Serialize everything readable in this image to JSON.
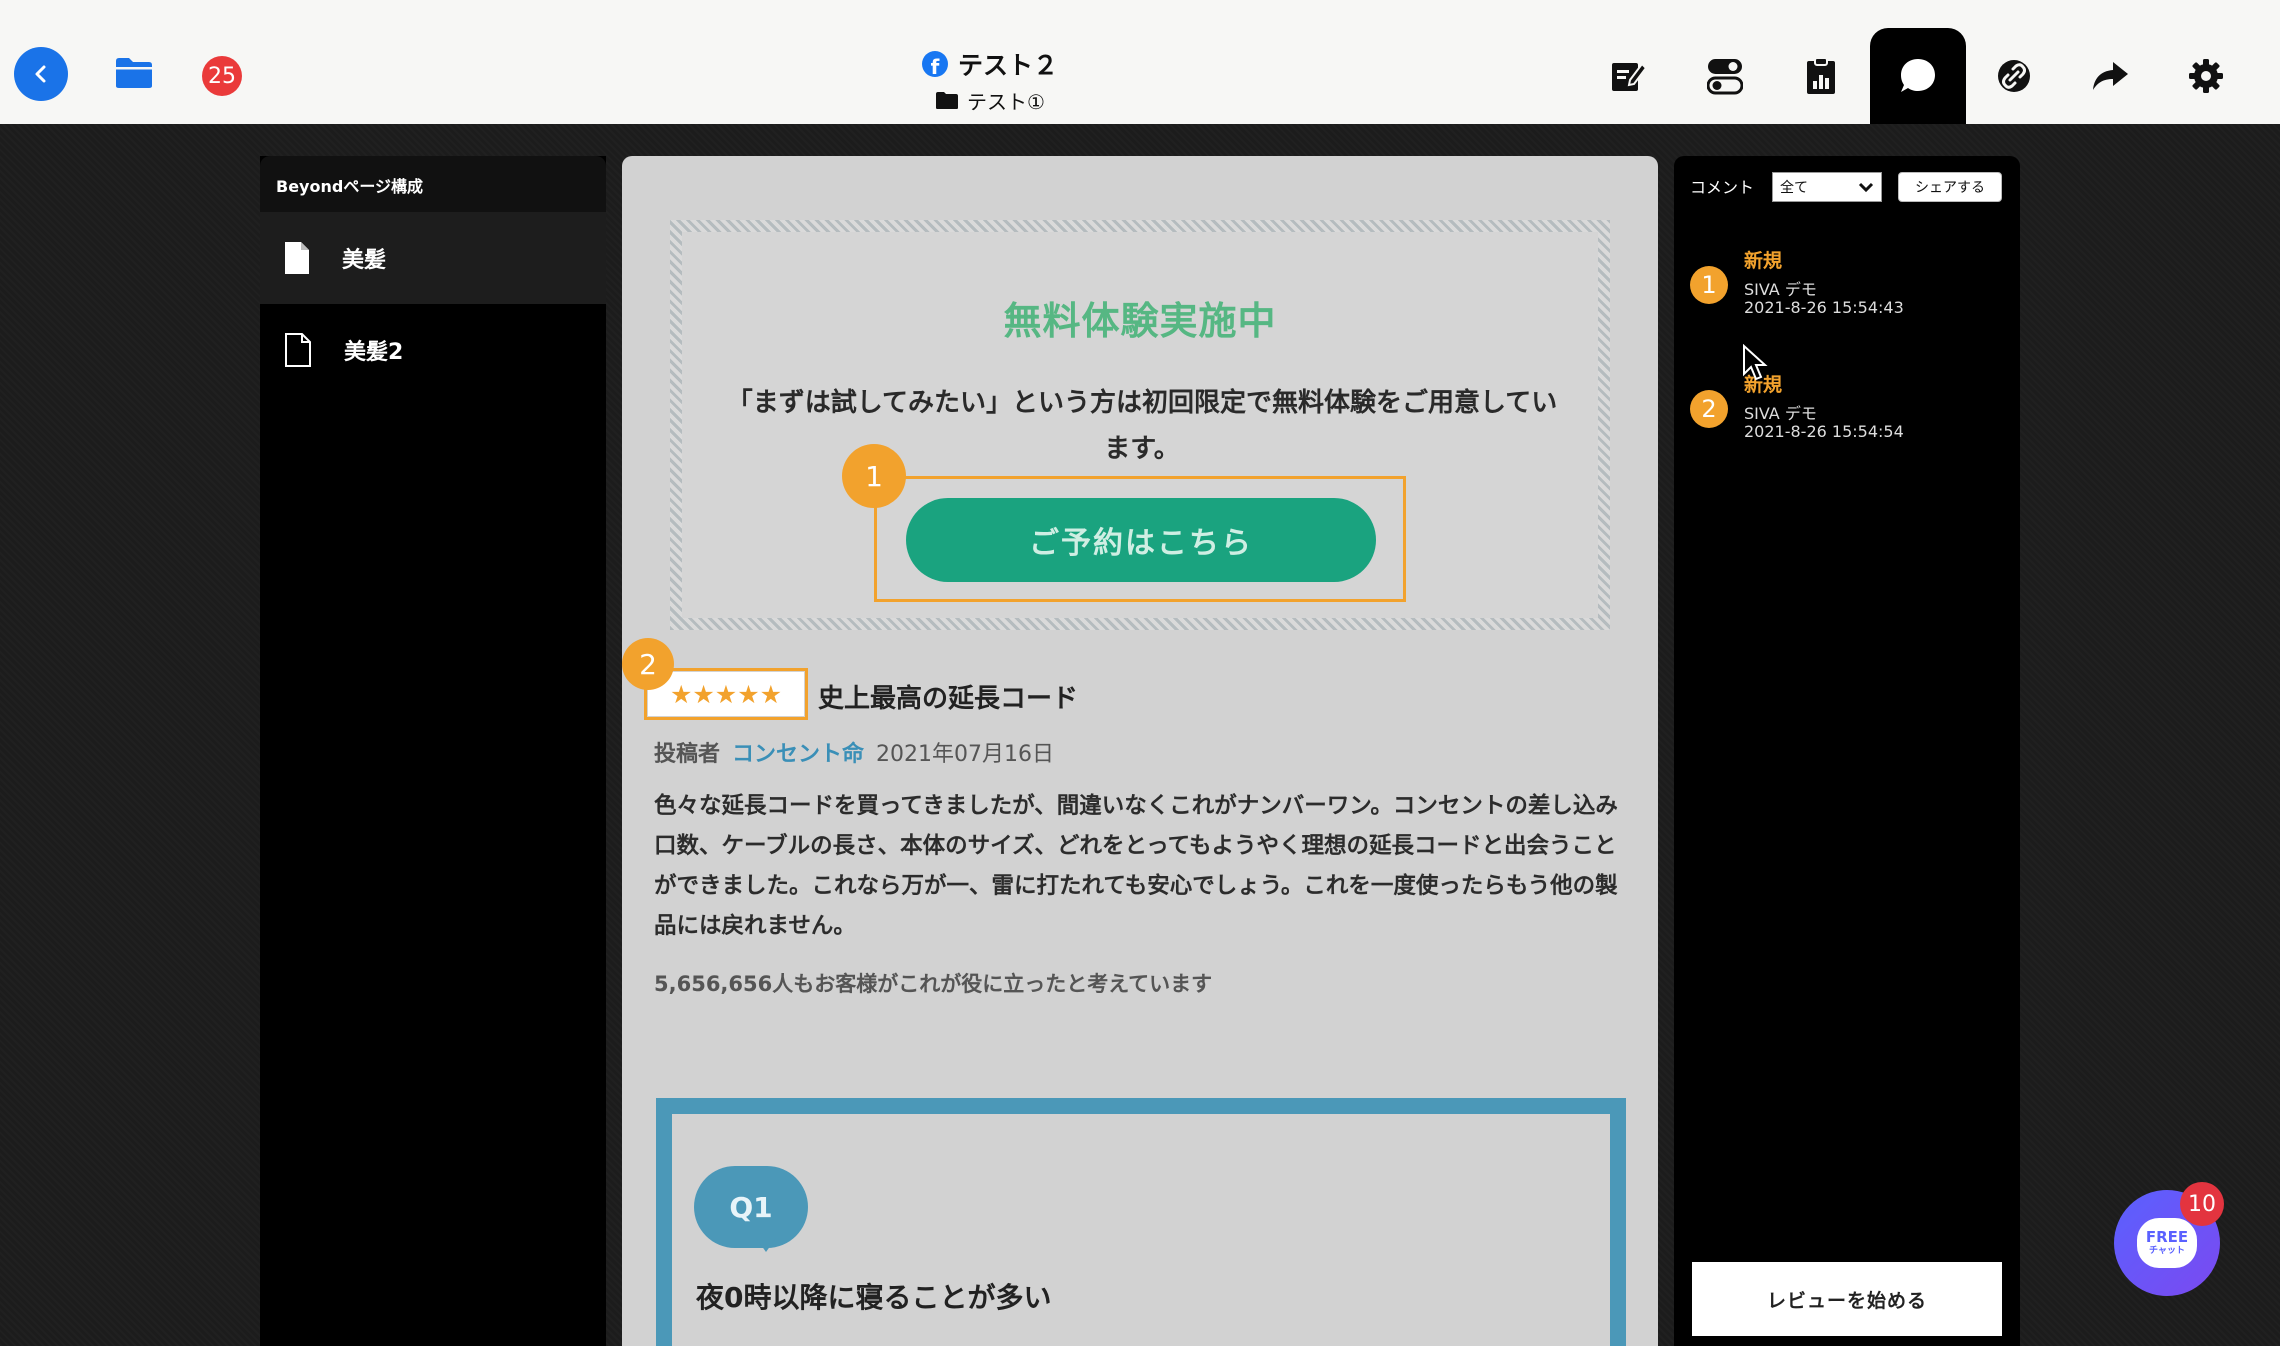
{
  "header": {
    "notification_count": "25",
    "title": "テスト２",
    "subtitle": "テスト①",
    "tools": [
      "edit-icon",
      "toggle-icon",
      "report-icon",
      "comment-icon",
      "link-icon",
      "share-icon",
      "gear-icon"
    ],
    "active_tool": "comment-icon"
  },
  "sidebar": {
    "title": "Beyondページ構成",
    "items": [
      {
        "label": "美髪",
        "selected": true
      },
      {
        "label": "美髪2",
        "selected": false
      }
    ]
  },
  "preview": {
    "promo_title": "無料体験実施中",
    "promo_text": "「まずは試してみたい」という方は初回限定で無料体験をご用意しています。",
    "cta_label": "ご予約はこちら",
    "review": {
      "stars": "★★★★★",
      "title": "史上最高の延長コード",
      "meta_label": "投稿者",
      "author": "コンセント命",
      "date": "2021年07月16日",
      "body": "色々な延長コードを買ってきましたが、間違いなくこれがナンバーワン。コンセントの差し込み口数、ケーブルの長さ、本体のサイズ、どれをとってもようやく理想の延長コードと出会うことができました。これなら万が一、雷に打たれても安心でしょう。これを一度使ったらもう他の製品には戻れません。",
      "helpful": "5,656,656人もお客様がこれが役に立ったと考えています"
    },
    "qa": {
      "badge": "Q1",
      "question": "夜0時以降に寝ることが多い"
    },
    "pins": [
      "1",
      "2"
    ]
  },
  "comments": {
    "label": "コメント",
    "filter_value": "全て",
    "share_label": "シェアする",
    "items": [
      {
        "number": "1",
        "status": "新規",
        "user": "SIVA デモ",
        "time": "2021-8-26 15:54:43"
      },
      {
        "number": "2",
        "status": "新規",
        "user": "SIVA デモ",
        "time": "2021-8-26 15:54:54"
      }
    ],
    "start_review_label": "レビューを始める"
  },
  "chat": {
    "label": "FREE",
    "sublabel": "チャット",
    "badge": "10"
  },
  "colors": {
    "accent_blue": "#1a73e8",
    "badge_red": "#ea3a3a",
    "pin_orange": "#f2a22d",
    "cta_green": "#1aa37f",
    "author_blue": "#3a8fb7"
  }
}
